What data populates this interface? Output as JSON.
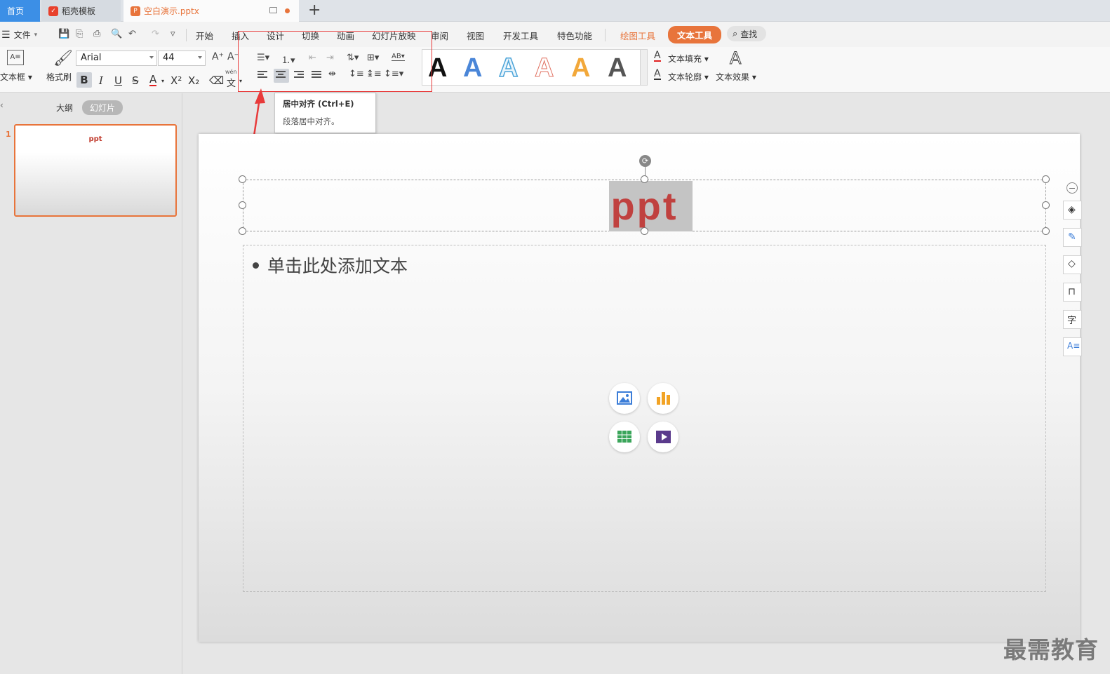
{
  "tabs": {
    "home": "首页",
    "template": "稻壳模板",
    "document": "空白演示.pptx"
  },
  "menu": {
    "file": "文件",
    "items": [
      "开始",
      "插入",
      "设计",
      "切换",
      "动画",
      "幻灯片放映",
      "审阅",
      "视图",
      "开发工具",
      "特色功能"
    ],
    "drawing_tools": "绘图工具",
    "text_tools": "文本工具",
    "search": "查找"
  },
  "ribbon": {
    "textbox_label": "文本框",
    "format_painter_label": "格式刷",
    "font_name": "Arial",
    "font_size": "44",
    "wen_label": "wén",
    "wen_char": "文",
    "text_fill": "文本填充",
    "text_outline": "文本轮廓",
    "text_effect": "文本效果",
    "style_letter": "A"
  },
  "tooltip": {
    "title": "居中对齐 (Ctrl+E)",
    "description": "段落居中对齐。"
  },
  "left_panel": {
    "outline_tab": "大纲",
    "slides_tab": "幻灯片",
    "slide_number": "1",
    "thumb_title": "ppt"
  },
  "slide": {
    "title": "ppt",
    "body_placeholder": "单击此处添加文本"
  },
  "watermark": "最需教育",
  "colors": {
    "accent": "#e8743b",
    "title_red": "#c0413f",
    "highlight_box": "#e83a3a",
    "home_tab": "#3c8fe6"
  }
}
